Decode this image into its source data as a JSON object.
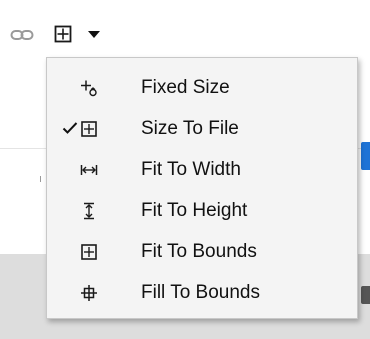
{
  "toolbar": {
    "buttons": [
      {
        "icon": "link-icon"
      },
      {
        "icon": "size-to-file-icon",
        "active": true
      },
      {
        "icon": "dropdown-arrow-icon"
      }
    ]
  },
  "menu": {
    "items": [
      {
        "label": "Fixed Size",
        "icon": "fixed-size-icon",
        "checked": false
      },
      {
        "label": "Size To File",
        "icon": "size-to-file-icon",
        "checked": true
      },
      {
        "label": "Fit To Width",
        "icon": "fit-to-width-icon",
        "checked": false
      },
      {
        "label": "Fit To Height",
        "icon": "fit-to-height-icon",
        "checked": false
      },
      {
        "label": "Fit To Bounds",
        "icon": "fit-to-bounds-icon",
        "checked": false
      },
      {
        "label": "Fill To Bounds",
        "icon": "fill-to-bounds-icon",
        "checked": false
      }
    ]
  },
  "colors": {
    "accent": "#1e73d6",
    "menu_background": "#f4f4f4",
    "text": "#111111"
  }
}
